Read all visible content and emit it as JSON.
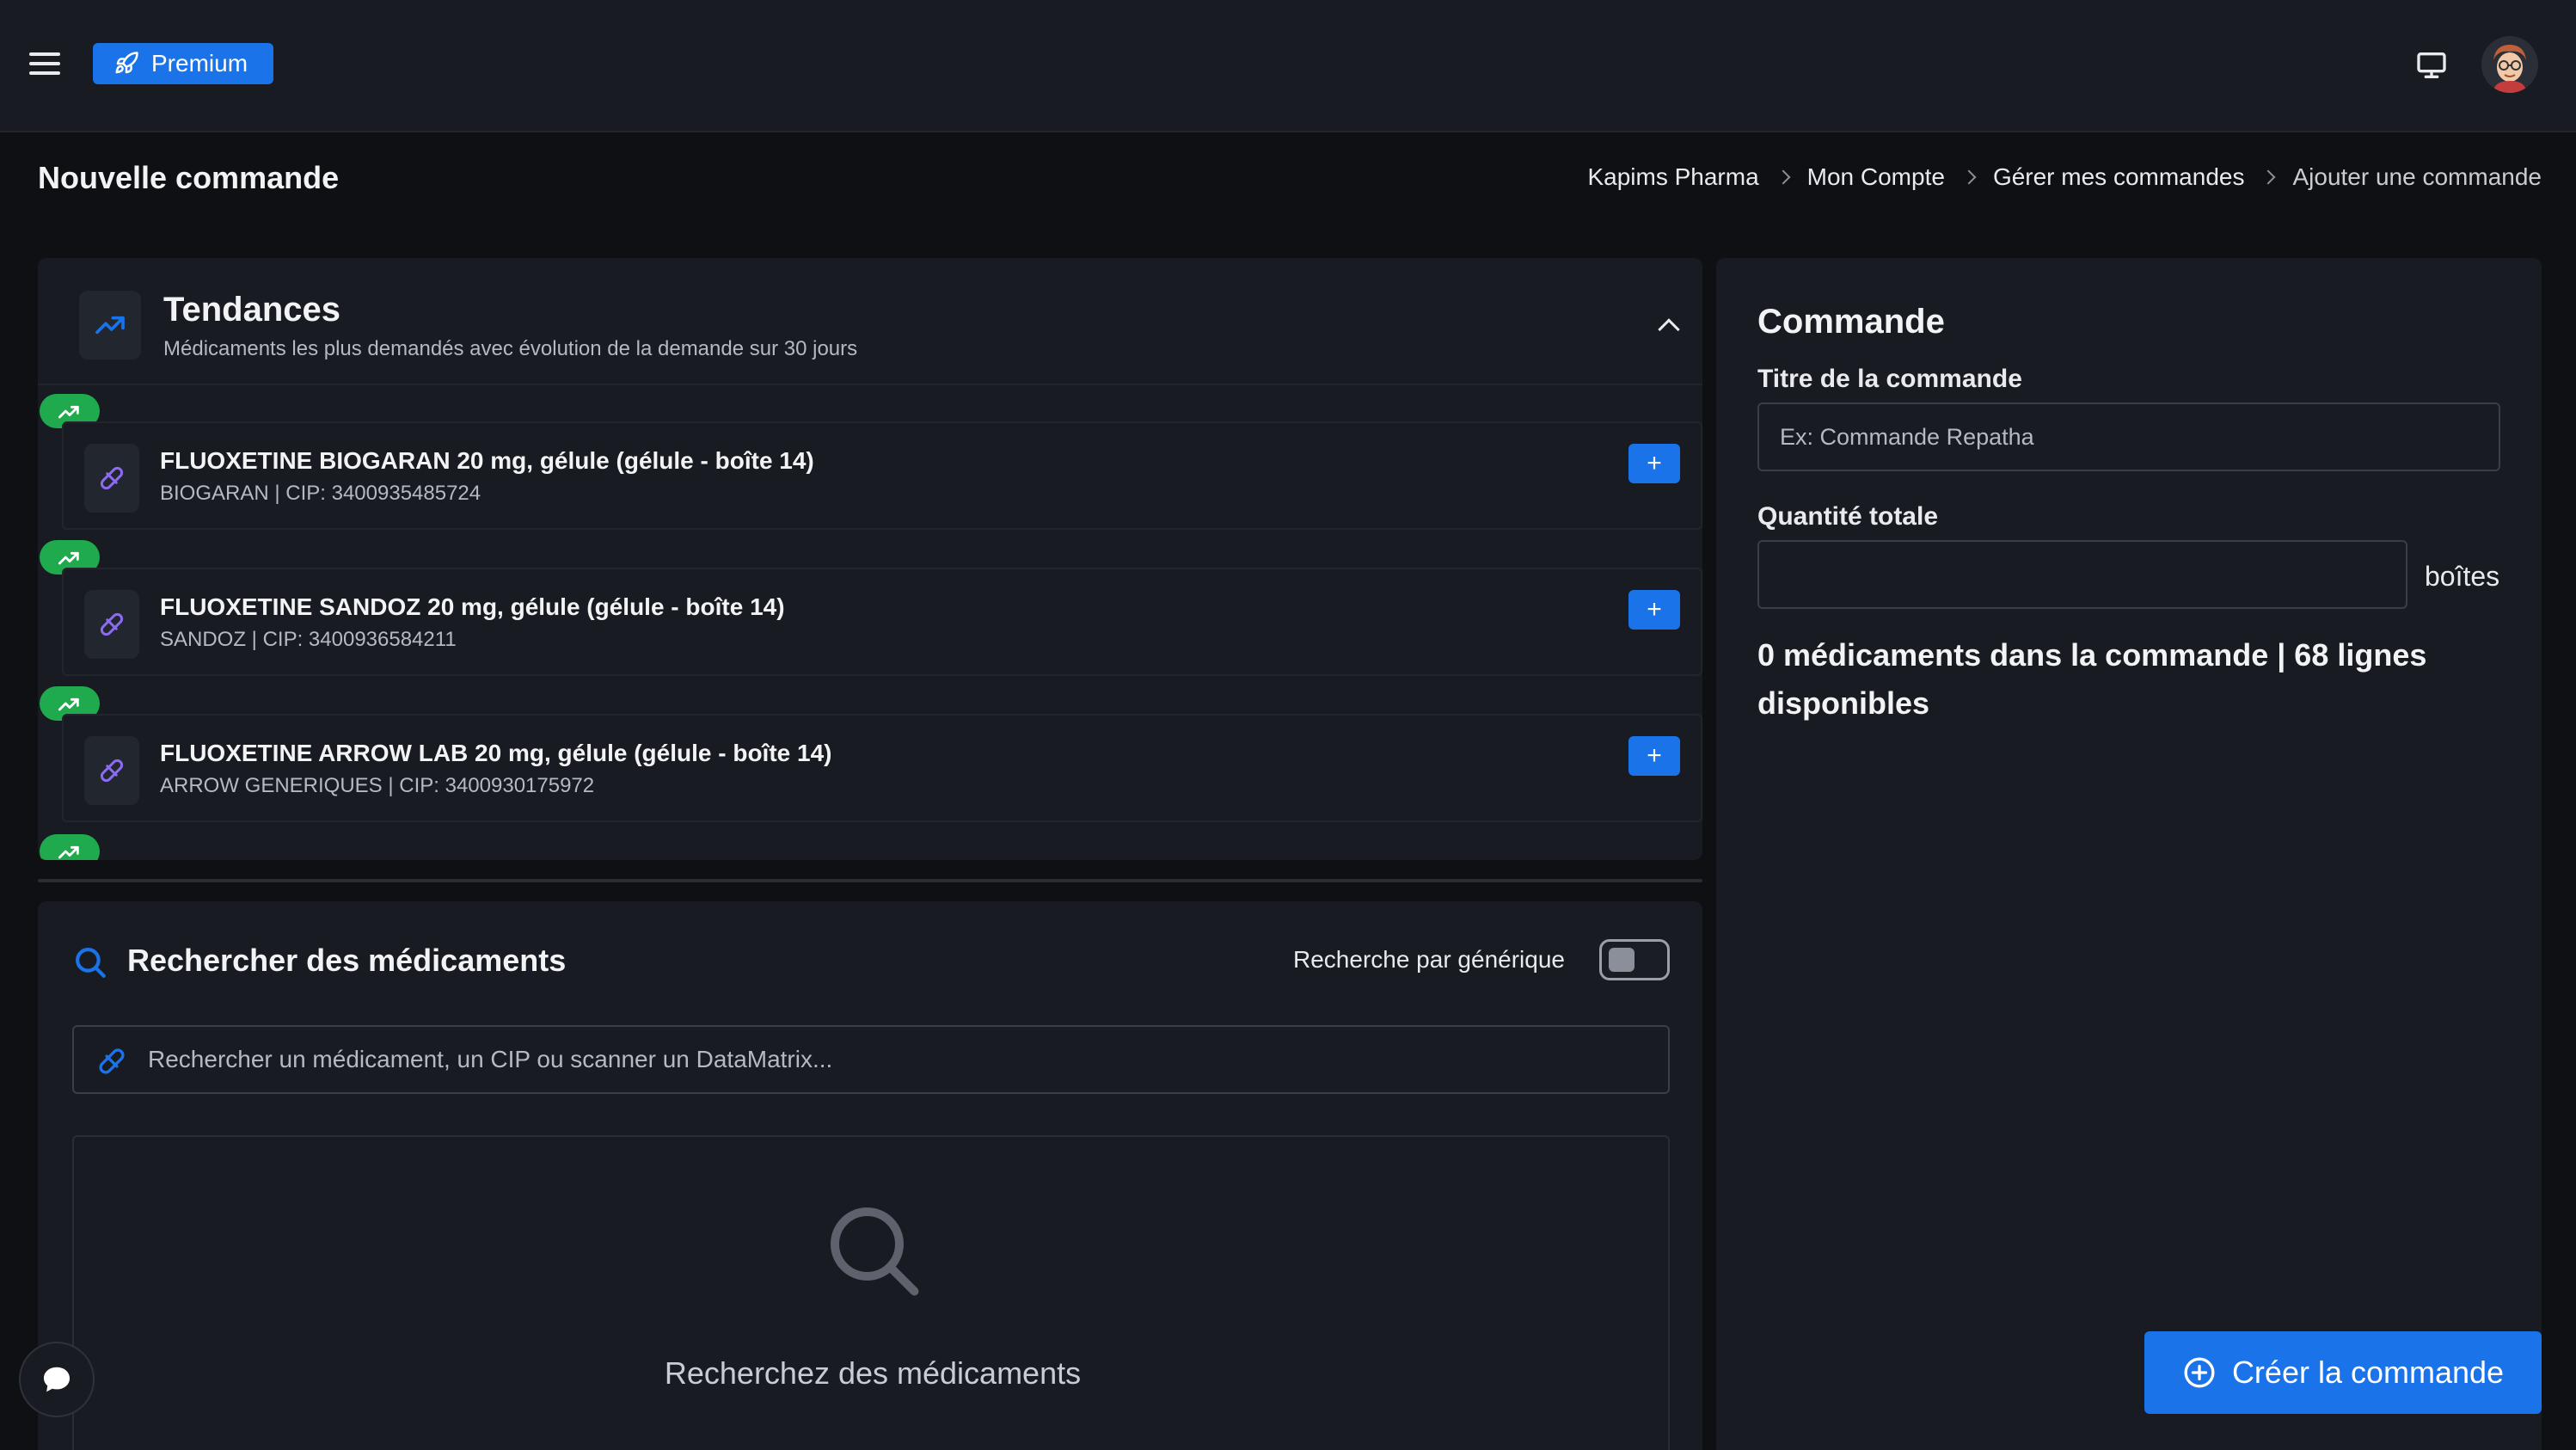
{
  "header": {
    "premium_label": "Premium",
    "icons": [
      "menu-icon",
      "rocket-icon",
      "monitor-icon",
      "avatar"
    ]
  },
  "page": {
    "title": "Nouvelle commande"
  },
  "breadcrumb": {
    "items": [
      "Kapims Pharma",
      "Mon Compte",
      "Gérer mes commandes",
      "Ajouter une commande"
    ]
  },
  "trends": {
    "title": "Tendances",
    "subtitle": "Médicaments les plus demandés avec évolution de la demande sur 30 jours",
    "add_label": "+",
    "items": [
      {
        "name": "FLUOXETINE BIOGARAN 20 mg, gélule (gélule - boîte 14)",
        "meta": "BIOGARAN | CIP: 3400935485724"
      },
      {
        "name": "FLUOXETINE SANDOZ 20 mg, gélule (gélule - boîte 14)",
        "meta": "SANDOZ | CIP: 3400936584211"
      },
      {
        "name": "FLUOXETINE ARROW LAB 20 mg, gélule (gélule - boîte 14)",
        "meta": "ARROW GENERIQUES | CIP: 3400930175972"
      }
    ]
  },
  "search": {
    "title": "Rechercher des médicaments",
    "generic_label": "Recherche par générique",
    "generic_enabled": false,
    "placeholder": "Rechercher un médicament, un CIP ou scanner un DataMatrix...",
    "empty_text": "Recherchez des médicaments"
  },
  "order": {
    "title": "Commande",
    "title_label": "Titre de la commande",
    "title_placeholder": "Ex: Commande Repatha",
    "title_value": "",
    "quantity_label": "Quantité totale",
    "quantity_value": "",
    "quantity_unit": "boîtes",
    "summary": "0 médicaments dans la commande | 68 lignes disponibles",
    "create_label": "Créer la commande"
  },
  "colors": {
    "accent": "#1a73e8",
    "trend_up": "#1faa4d",
    "pill_icon": "#8b6cf0",
    "background": "#0e1014",
    "card": "#181b21"
  }
}
